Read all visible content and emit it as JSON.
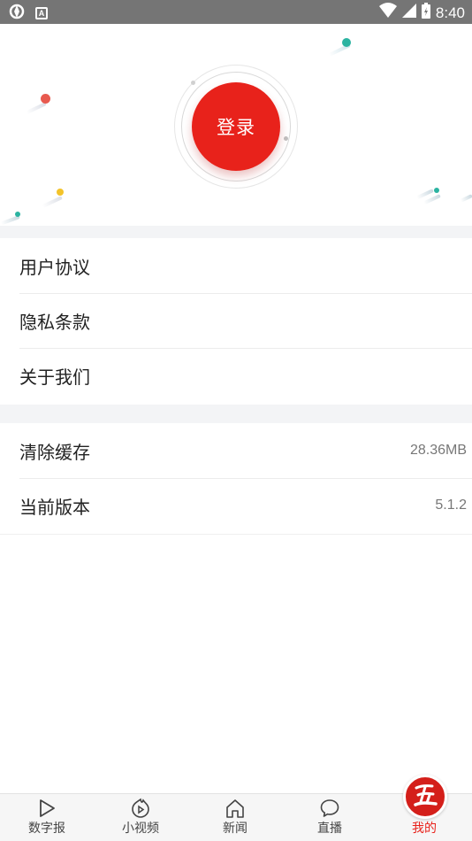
{
  "status_bar": {
    "time": "8:40",
    "left_icons": [
      "sync-icon",
      "a-badge-icon"
    ],
    "right_icons": [
      "wifi-icon",
      "signal-icon",
      "battery-icon"
    ]
  },
  "hero": {
    "login_label": "登录",
    "accent": "#e8221b"
  },
  "menu_group_1": {
    "items": [
      {
        "label": "用户协议"
      },
      {
        "label": "隐私条款"
      },
      {
        "label": "关于我们"
      }
    ]
  },
  "menu_group_2": {
    "items": [
      {
        "label": "清除缓存",
        "value": "28.36MB"
      },
      {
        "label": "当前版本",
        "value": "5.1.2"
      }
    ]
  },
  "bottom_nav": {
    "items": [
      {
        "label": "数字报",
        "icon": "play-triangle-icon"
      },
      {
        "label": "小视频",
        "icon": "video-play-icon"
      },
      {
        "label": "新闻",
        "icon": "home-icon"
      },
      {
        "label": "直播",
        "icon": "chat-bubble-icon"
      },
      {
        "label": "我的",
        "icon": "mine-logo-icon",
        "active": true
      }
    ]
  }
}
